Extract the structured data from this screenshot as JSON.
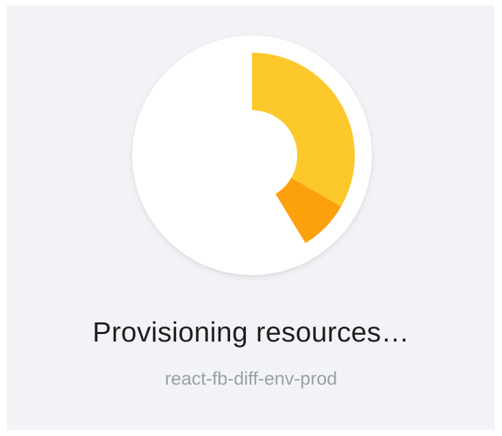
{
  "status": {
    "title": "Provisioning resources…",
    "environment": "react-fb-diff-env-prod"
  },
  "spinner": {
    "segments": [
      {
        "name": "primary-segment",
        "color": "#fdc82b",
        "fraction": 0.333
      },
      {
        "name": "secondary-segment",
        "color": "#fca00c",
        "fraction": 0.08
      }
    ],
    "disc_color": "#ffffff"
  },
  "colors": {
    "background": "#f1f3f6",
    "title": "#1f1f1f",
    "subtitle": "#9aa0a6"
  }
}
